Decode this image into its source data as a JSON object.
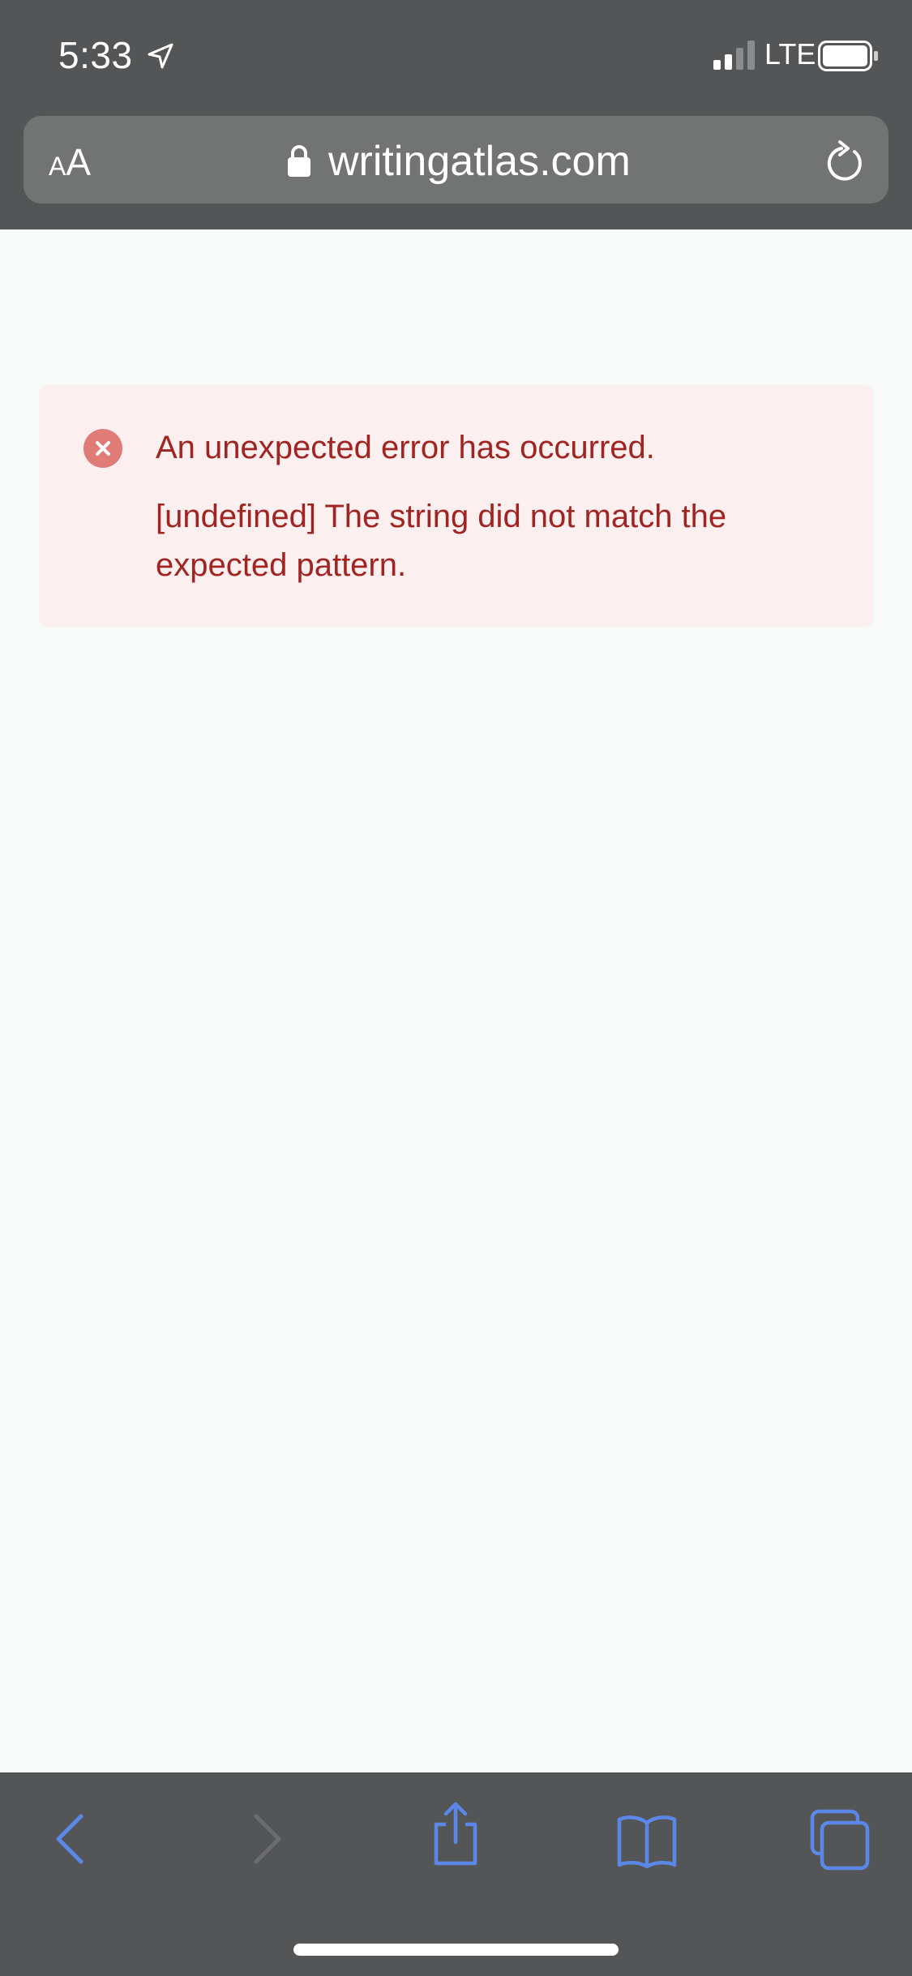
{
  "status_bar": {
    "time": "5:33",
    "network": "LTE"
  },
  "address_bar": {
    "text_size_button": {
      "small": "A",
      "large": "A"
    },
    "url": "writingatlas.com"
  },
  "error": {
    "title": "An unexpected error has occurred.",
    "detail": "[undefined] The string did not match the expected pattern."
  },
  "toolbar": {
    "items": [
      "back-icon",
      "forward-icon",
      "share-icon",
      "bookmarks-icon",
      "tabs-icon"
    ]
  },
  "colors": {
    "chrome_bg": "#545556",
    "urlbar_bg": "#727373",
    "page_bg": "#f8f9f9",
    "error_bg": "#fcefef",
    "error_text": "#a02421",
    "error_icon": "#e07b78",
    "toolbar_accent": "#5b87e8",
    "toolbar_disabled": "#6c6d6e"
  }
}
